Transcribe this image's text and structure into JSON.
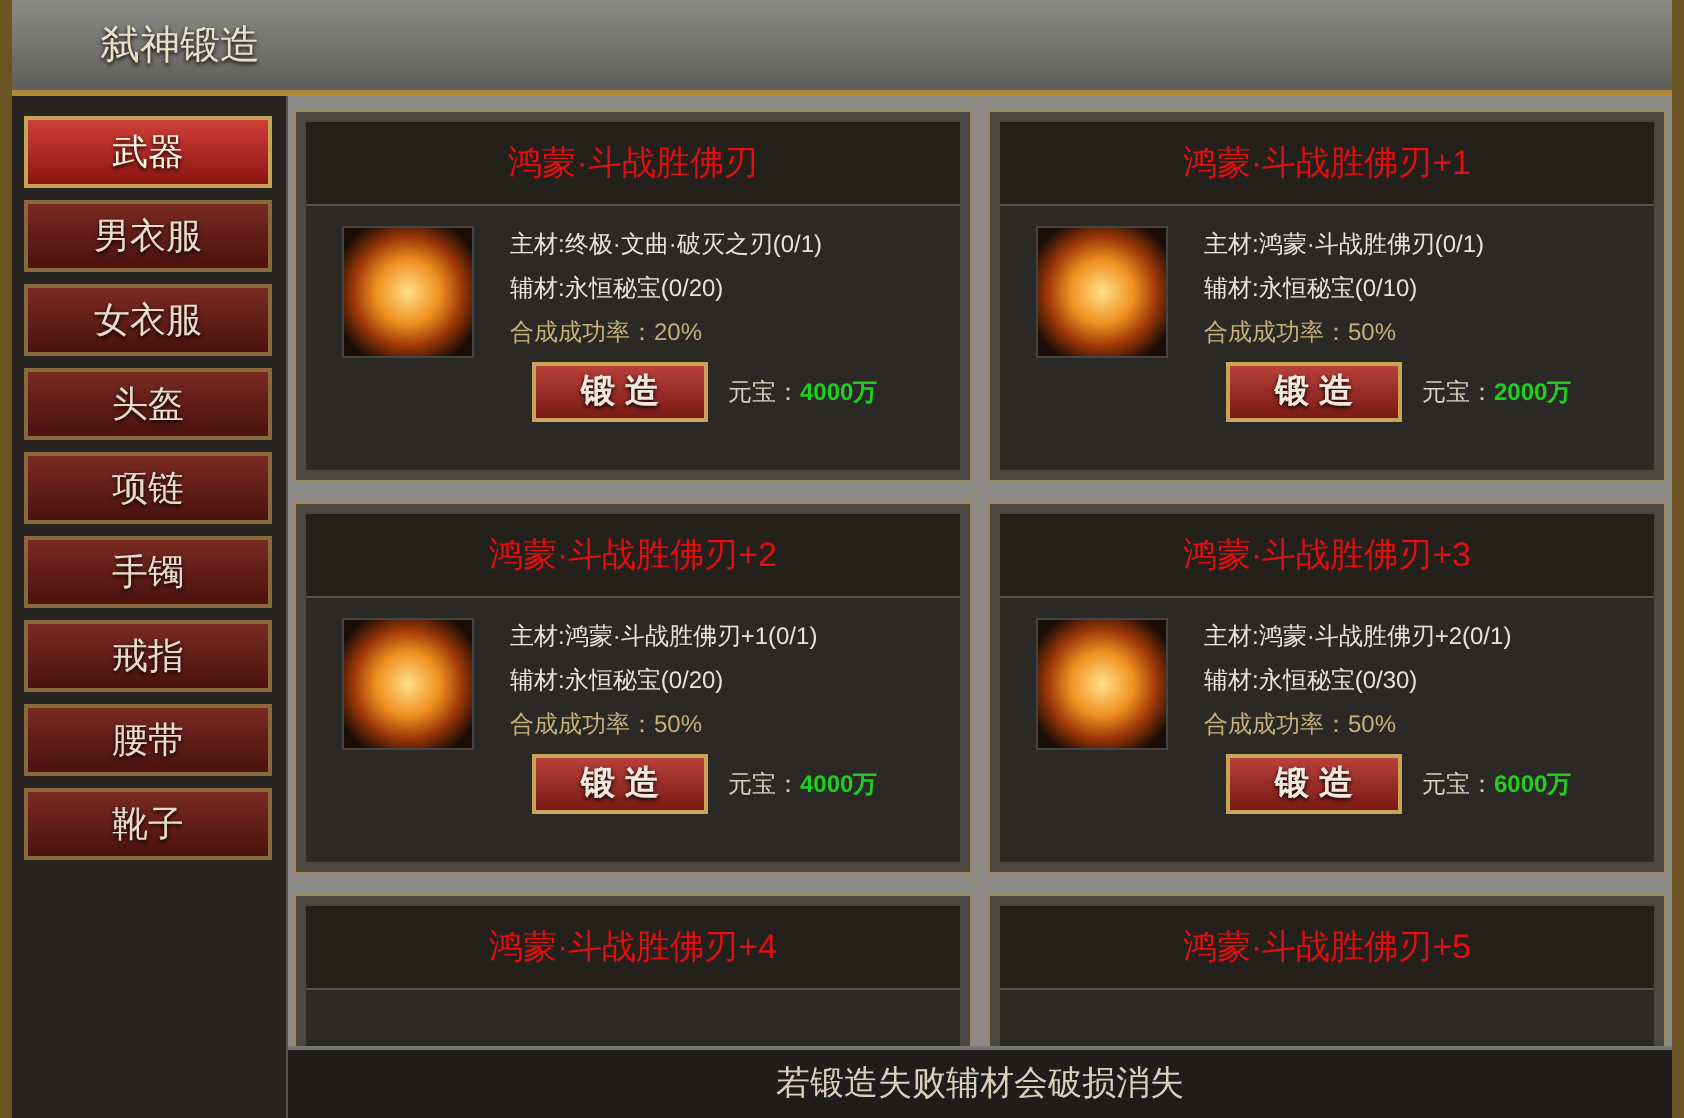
{
  "window": {
    "title": "弑神锻造"
  },
  "sidebar": {
    "items": [
      {
        "label": "武器",
        "selected": true
      },
      {
        "label": "男衣服",
        "selected": false
      },
      {
        "label": "女衣服",
        "selected": false
      },
      {
        "label": "头盔",
        "selected": false
      },
      {
        "label": "项链",
        "selected": false
      },
      {
        "label": "手镯",
        "selected": false
      },
      {
        "label": "戒指",
        "selected": false
      },
      {
        "label": "腰带",
        "selected": false
      },
      {
        "label": "靴子",
        "selected": false
      }
    ]
  },
  "recipes": [
    {
      "title": "鸿蒙·斗战胜佛刃",
      "main_material": "主材:终极·文曲·破灭之刃(0/1)",
      "sub_material": "辅材:永恒秘宝(0/20)",
      "success_rate": "合成成功率：20%",
      "button": "锻 造",
      "cost_label": "元宝：",
      "cost": "4000万"
    },
    {
      "title": "鸿蒙·斗战胜佛刃+1",
      "main_material": "主材:鸿蒙·斗战胜佛刃(0/1)",
      "sub_material": "辅材:永恒秘宝(0/10)",
      "success_rate": "合成成功率：50%",
      "button": "锻 造",
      "cost_label": "元宝：",
      "cost": "2000万"
    },
    {
      "title": "鸿蒙·斗战胜佛刃+2",
      "main_material": "主材:鸿蒙·斗战胜佛刃+1(0/1)",
      "sub_material": "辅材:永恒秘宝(0/20)",
      "success_rate": "合成成功率：50%",
      "button": "锻 造",
      "cost_label": "元宝：",
      "cost": "4000万"
    },
    {
      "title": "鸿蒙·斗战胜佛刃+3",
      "main_material": "主材:鸿蒙·斗战胜佛刃+2(0/1)",
      "sub_material": "辅材:永恒秘宝(0/30)",
      "success_rate": "合成成功率：50%",
      "button": "锻 造",
      "cost_label": "元宝：",
      "cost": "6000万"
    },
    {
      "title": "鸿蒙·斗战胜佛刃+4"
    },
    {
      "title": "鸿蒙·斗战胜佛刃+5"
    }
  ],
  "footer": {
    "note": "若锻造失败辅材会破损消失"
  }
}
